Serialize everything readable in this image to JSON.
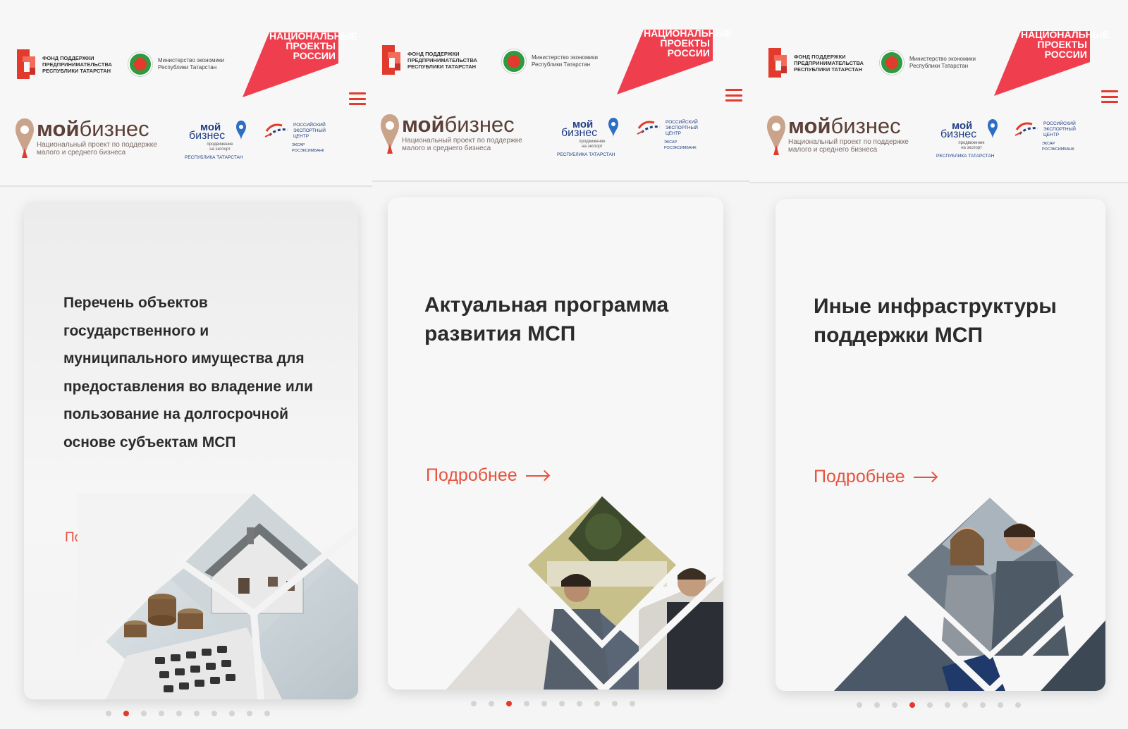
{
  "brand": {
    "frp_text": "ФОНД ПОДДЕРЖКИ ПРЕДПРИНИМАТЕЛЬСТВА РЕСПУБЛИКИ ТАТАРСТАН",
    "ministry_text": "Министерство экономики Республики Татарстан",
    "national_projects_text": "НАЦИОНАЛЬНЫЕ ПРОЕКТЫ РОССИИ",
    "moy_biznes_word_bold": "мой",
    "moy_biznes_word_rest": "бизнес",
    "moy_biznes_sub": "Национальный проект по поддержке малого и среднего бизнеса",
    "mb2_top": "мой",
    "mb2_mid": "бизнес",
    "mb2_small": "продвижение на экспорт",
    "mb2_region": "РЕСПУБЛИКА ТАТАРСТАН",
    "rec_text": "РОССИЙСКИЙ ЭКСПОРТНЫЙ ЦЕНТР",
    "rec_sub1": "ЭКСАР",
    "rec_sub2": "РОСЭКСИМБАНК"
  },
  "colors": {
    "accent": "#e23b2e",
    "link": "#e6533f",
    "brown": "#5c4037",
    "navy": "#1e3e83"
  },
  "icons": {
    "menu": "hamburger-menu-icon",
    "arrow": "arrow-right-icon"
  },
  "panels": [
    {
      "title": "Перечень объектов государственного и муниципального имущества для предоставления во владение или пользование на долгосрочной основе субъектам МСП",
      "more_label": "Подробнее",
      "dots_total": 10,
      "active_dot": 2
    },
    {
      "title": "Актуальная программа развития МСП",
      "more_label": "Подробнее",
      "dots_total": 10,
      "active_dot": 3
    },
    {
      "title": "Иные инфраструктуры поддержки МСП",
      "more_label": "Подробнее",
      "dots_total": 10,
      "active_dot": 4
    }
  ]
}
